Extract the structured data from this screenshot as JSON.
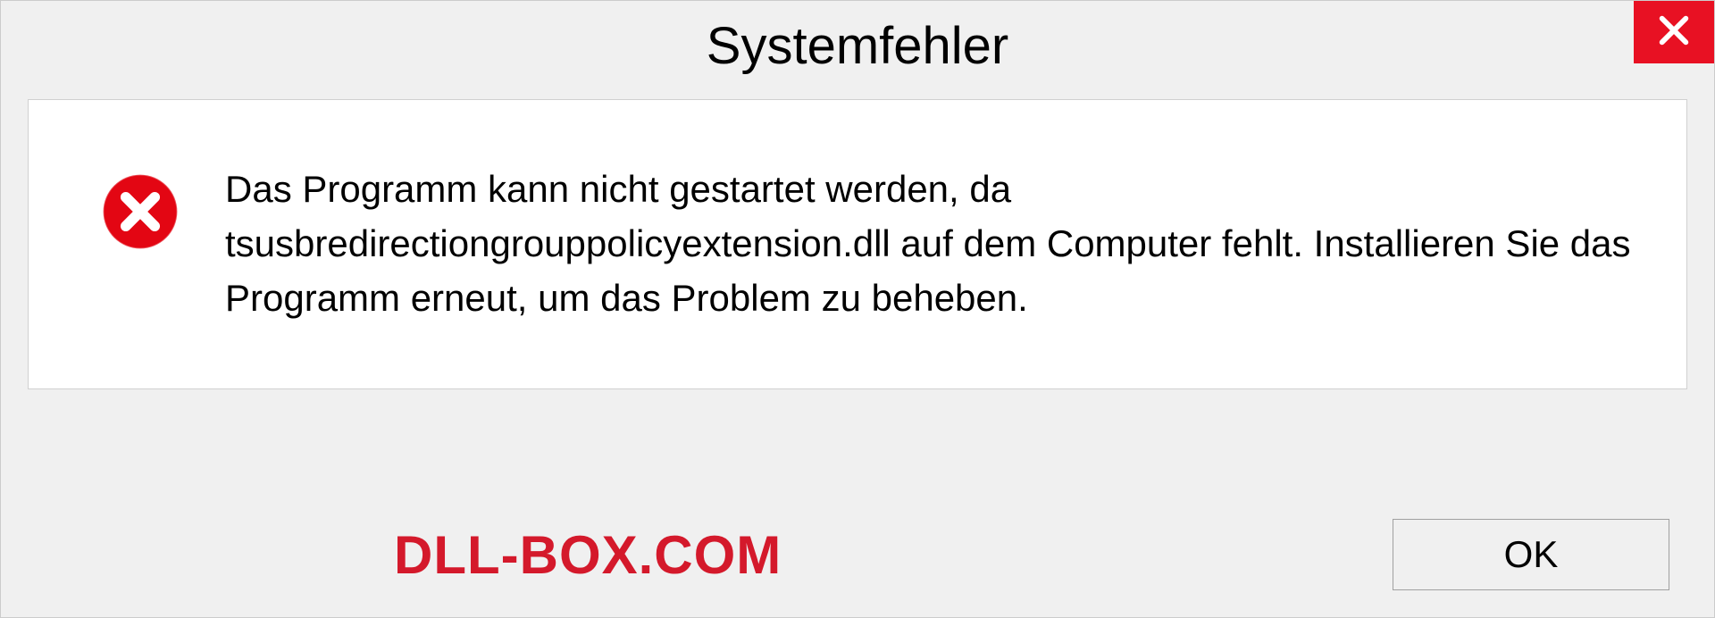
{
  "dialog": {
    "title": "Systemfehler",
    "message": "Das Programm kann nicht gestartet werden, da tsusbredirectiongrouppolicyextension.dll auf dem Computer fehlt. Installieren Sie das Programm erneut, um das Problem zu beheben.",
    "ok_label": "OK"
  },
  "watermark": "DLL-BOX.COM",
  "colors": {
    "close_button": "#e81123",
    "error_icon": "#e30613",
    "watermark": "#d4192b"
  }
}
